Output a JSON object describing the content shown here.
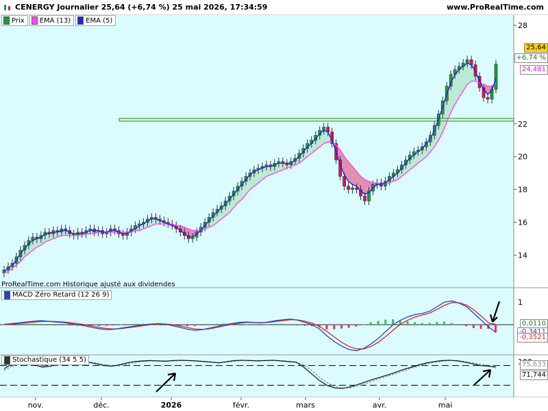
{
  "header": {
    "title": "CENERGY Journalier 25,64 (+6,74 %) 25 mai 2026, 17:34:59",
    "brand": "www.ProRealTime.com"
  },
  "legend": [
    {
      "label": "Prix",
      "color": "#1e9a3e"
    },
    {
      "label": "EMA (13)",
      "color": "#ff44ff"
    },
    {
      "label": "EMA (5)",
      "color": "#2222dd"
    }
  ],
  "note": "ProRealTime.com  Historique ajusté aux dividendes",
  "price_tags": {
    "last": "25,64",
    "change": "+6,74 %",
    "ema13": "24,481"
  },
  "macd": {
    "label": "MACD Zéro Retard (12 26 9)",
    "tag_signal": "0,0110",
    "tag_hist": "-0,3521",
    "tag_line": "-0,3411",
    "axis_ticks": [
      "1"
    ]
  },
  "stoch": {
    "label": "Stochastique (34 5 5)",
    "tag_k": "75,633",
    "tag_d": "71,744",
    "axis_ticks": [
      "100"
    ]
  },
  "colors": {
    "up": "#1e9a3e",
    "down": "#d4145a",
    "ema5": "#2222dd",
    "ema13": "#ff44ff",
    "bg": "#dcfbff",
    "resistance": "#4aa63a",
    "macd_line": "#2244cc",
    "macd_signal": "#dd2222"
  },
  "chart_data": [
    {
      "type": "candlestick",
      "title": "CENERGY Journalier",
      "yticks": [
        14,
        16,
        18,
        20,
        22,
        28
      ],
      "ylim": [
        12.6,
        28.5
      ],
      "x_labels": [
        "nov.",
        "déc.",
        "2026",
        "févr.",
        "mars",
        "avr.",
        "mai"
      ],
      "resistance_level": 22.25,
      "close_series": [
        13.1,
        13.3,
        13.5,
        13.9,
        14.3,
        14.6,
        14.9,
        15.1,
        15.0,
        15.2,
        15.4,
        15.3,
        15.5,
        15.4,
        15.6,
        15.5,
        15.3,
        15.2,
        15.4,
        15.3,
        15.5,
        15.6,
        15.4,
        15.5,
        15.3,
        15.4,
        15.6,
        15.5,
        15.3,
        15.2,
        15.4,
        15.6,
        15.8,
        15.9,
        16.0,
        16.2,
        16.3,
        16.2,
        16.1,
        16.0,
        15.9,
        15.8,
        15.6,
        15.4,
        15.2,
        15.0,
        15.1,
        15.4,
        15.7,
        16.0,
        16.3,
        16.6,
        16.8,
        17.0,
        17.3,
        17.6,
        17.9,
        18.2,
        18.5,
        18.8,
        19.0,
        19.2,
        19.3,
        19.4,
        19.5,
        19.4,
        19.6,
        19.7,
        19.6,
        19.5,
        19.7,
        19.9,
        20.2,
        20.5,
        20.8,
        21.0,
        21.3,
        21.6,
        21.8,
        21.5,
        20.8,
        19.8,
        18.8,
        18.2,
        18.0,
        18.1,
        18.0,
        17.6,
        17.3,
        17.9,
        18.3,
        18.4,
        18.2,
        18.5,
        18.8,
        19.0,
        19.2,
        19.5,
        19.8,
        20.1,
        20.3,
        20.4,
        20.6,
        20.9,
        21.3,
        21.9,
        22.6,
        23.4,
        24.3,
        25.0,
        25.3,
        25.5,
        25.7,
        25.9,
        25.6,
        24.9,
        24.2,
        23.6,
        23.5,
        24.1,
        25.64
      ],
      "ema5_series": [
        13.0,
        13.2,
        13.4,
        13.7,
        14.1,
        14.4,
        14.7,
        14.9,
        15.0,
        15.1,
        15.3,
        15.3,
        15.4,
        15.4,
        15.5,
        15.5,
        15.4,
        15.3,
        15.3,
        15.3,
        15.4,
        15.5,
        15.5,
        15.5,
        15.4,
        15.4,
        15.5,
        15.5,
        15.4,
        15.3,
        15.3,
        15.5,
        15.6,
        15.8,
        15.9,
        16.1,
        16.2,
        16.2,
        16.1,
        16.0,
        15.9,
        15.8,
        15.7,
        15.5,
        15.3,
        15.1,
        15.1,
        15.3,
        15.5,
        15.8,
        16.1,
        16.4,
        16.6,
        16.9,
        17.1,
        17.4,
        17.7,
        18.0,
        18.3,
        18.6,
        18.9,
        19.1,
        19.2,
        19.3,
        19.4,
        19.4,
        19.5,
        19.6,
        19.6,
        19.6,
        19.6,
        19.8,
        20.0,
        20.3,
        20.6,
        20.8,
        21.1,
        21.4,
        21.6,
        21.5,
        21.0,
        20.3,
        19.5,
        18.9,
        18.5,
        18.3,
        18.2,
        17.9,
        17.7,
        17.8,
        18.1,
        18.3,
        18.3,
        18.4,
        18.6,
        18.8,
        19.0,
        19.3,
        19.6,
        19.9,
        20.1,
        20.3,
        20.5,
        20.8,
        21.1,
        21.6,
        22.3,
        23.0,
        23.8,
        24.5,
        25.0,
        25.3,
        25.5,
        25.7,
        25.6,
        25.2,
        24.6,
        24.1,
        23.8,
        24.0,
        24.8
      ],
      "ema13_series": [
        12.9,
        13.0,
        13.2,
        13.4,
        13.6,
        13.9,
        14.1,
        14.3,
        14.5,
        14.6,
        14.8,
        14.9,
        15.0,
        15.1,
        15.2,
        15.2,
        15.2,
        15.2,
        15.2,
        15.2,
        15.3,
        15.3,
        15.3,
        15.4,
        15.4,
        15.4,
        15.4,
        15.4,
        15.4,
        15.4,
        15.4,
        15.4,
        15.5,
        15.5,
        15.6,
        15.7,
        15.8,
        15.9,
        15.9,
        15.9,
        15.9,
        15.9,
        15.8,
        15.8,
        15.7,
        15.6,
        15.5,
        15.5,
        15.5,
        15.6,
        15.7,
        15.8,
        16.0,
        16.2,
        16.4,
        16.6,
        16.9,
        17.2,
        17.4,
        17.7,
        18.0,
        18.2,
        18.4,
        18.6,
        18.8,
        18.9,
        19.0,
        19.1,
        19.2,
        19.3,
        19.4,
        19.5,
        19.6,
        19.8,
        20.0,
        20.2,
        20.4,
        20.6,
        20.8,
        20.9,
        20.9,
        20.7,
        20.4,
        20.0,
        19.7,
        19.4,
        19.1,
        18.8,
        18.6,
        18.5,
        18.4,
        18.4,
        18.3,
        18.4,
        18.4,
        18.5,
        18.6,
        18.8,
        19.0,
        19.2,
        19.4,
        19.6,
        19.8,
        20.0,
        20.3,
        20.6,
        21.0,
        21.5,
        22.1,
        22.7,
        23.2,
        23.6,
        24.0,
        24.4,
        24.6,
        24.6,
        24.5,
        24.4,
        24.3,
        24.3,
        24.481
      ]
    },
    {
      "type": "line",
      "title": "MACD Zéro Retard (12 26 9)",
      "series": [
        {
          "name": "MACD",
          "values": [
            0.02,
            0.05,
            0.08,
            0.12,
            0.15,
            0.18,
            0.15,
            0.12,
            0.1,
            0.05,
            0.0,
            -0.05,
            -0.12,
            -0.18,
            -0.22,
            -0.2,
            -0.15,
            -0.1,
            -0.05,
            0.0,
            0.03,
            0.05,
            0.02,
            -0.05,
            -0.12,
            -0.2,
            -0.25,
            -0.22,
            -0.15,
            -0.08,
            0.0,
            0.05,
            0.1,
            0.12,
            0.1,
            0.08,
            0.12,
            0.18,
            0.22,
            0.25,
            0.2,
            0.1,
            0.0,
            -0.2,
            -0.5,
            -0.75,
            -0.95,
            -1.1,
            -1.15,
            -1.05,
            -0.85,
            -0.6,
            -0.3,
            0.0,
            0.2,
            0.35,
            0.45,
            0.5,
            0.6,
            0.8,
            1.0,
            1.05,
            0.95,
            0.8,
            0.5,
            0.2,
            -0.1,
            -0.34
          ]
        },
        {
          "name": "Signal",
          "values": [
            0.0,
            0.02,
            0.05,
            0.08,
            0.11,
            0.14,
            0.15,
            0.14,
            0.12,
            0.09,
            0.05,
            0.0,
            -0.06,
            -0.12,
            -0.17,
            -0.19,
            -0.17,
            -0.13,
            -0.09,
            -0.04,
            0.0,
            0.03,
            0.03,
            0.0,
            -0.06,
            -0.13,
            -0.19,
            -0.21,
            -0.18,
            -0.12,
            -0.05,
            0.01,
            0.06,
            0.1,
            0.1,
            0.09,
            0.1,
            0.14,
            0.18,
            0.22,
            0.21,
            0.15,
            0.07,
            -0.08,
            -0.3,
            -0.55,
            -0.78,
            -0.96,
            -1.07,
            -1.07,
            -0.96,
            -0.77,
            -0.52,
            -0.24,
            0.02,
            0.2,
            0.34,
            0.43,
            0.52,
            0.68,
            0.86,
            0.98,
            0.97,
            0.87,
            0.65,
            0.38,
            0.08,
            0.01
          ]
        }
      ]
    },
    {
      "type": "line",
      "title": "Stochastique (34 5 5)",
      "series": [
        {
          "name": "%K",
          "values": [
            70,
            85,
            90,
            88,
            82,
            75,
            78,
            85,
            88,
            90,
            92,
            90,
            85,
            80,
            78,
            82,
            88,
            92,
            94,
            95,
            94,
            93,
            95,
            96,
            95,
            94,
            92,
            90,
            88,
            92,
            95,
            96,
            95,
            94,
            95,
            96,
            94,
            92,
            90,
            75,
            55,
            35,
            20,
            12,
            10,
            15,
            22,
            30,
            38,
            45,
            52,
            60,
            68,
            75,
            82,
            88,
            92,
            95,
            96,
            94,
            90,
            85,
            80,
            78,
            75.6
          ]
        },
        {
          "name": "%D",
          "values": [
            65,
            78,
            86,
            89,
            86,
            80,
            77,
            81,
            85,
            88,
            90,
            91,
            88,
            83,
            80,
            80,
            84,
            89,
            92,
            94,
            94,
            94,
            94,
            95,
            95,
            94,
            93,
            91,
            89,
            90,
            93,
            95,
            95,
            95,
            95,
            95,
            95,
            93,
            91,
            82,
            65,
            45,
            28,
            17,
            12,
            12,
            18,
            25,
            33,
            41,
            48,
            56,
            64,
            72,
            79,
            85,
            90,
            93,
            95,
            95,
            92,
            88,
            84,
            80,
            71.7
          ]
        }
      ]
    }
  ]
}
